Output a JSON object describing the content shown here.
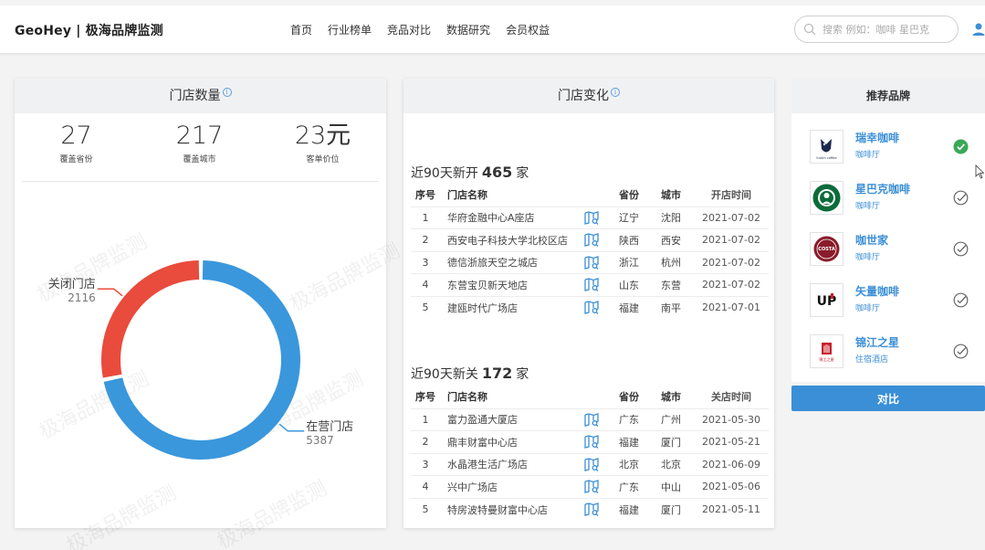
{
  "header": {
    "brand": "GeoHey | 极海品牌监测",
    "nav": [
      "首页",
      "行业榜单",
      "竞品对比",
      "数据研究",
      "会员权益"
    ],
    "search_placeholder": "搜索 例如：咖啡 星巴克"
  },
  "store_count": {
    "title": "门店数量",
    "stats": [
      {
        "value": "27",
        "label": "覆盖省份"
      },
      {
        "value": "217",
        "label": "覆盖城市"
      },
      {
        "value": "23元",
        "label": "客单价位"
      }
    ],
    "watermark": "极海品牌监测",
    "chart_data": {
      "type": "pie",
      "style": "donut",
      "slices": [
        {
          "label": "在营门店",
          "value": 5387,
          "color": "#3a97dc"
        },
        {
          "label": "关闭门店",
          "value": 2116,
          "color": "#e94b3c"
        }
      ]
    }
  },
  "store_change": {
    "title": "门店变化",
    "columns": [
      "序号",
      "门店名称",
      "省份",
      "城市"
    ],
    "opened": {
      "prefix": "近90天新开",
      "count": "465",
      "unit": "家",
      "date_col": "开店时间",
      "rows": [
        {
          "no": "1",
          "name": "华府金融中心A座店",
          "prov": "辽宁",
          "city": "沈阳",
          "date": "2021-07-02"
        },
        {
          "no": "2",
          "name": "西安电子科技大学北校区店",
          "prov": "陕西",
          "city": "西安",
          "date": "2021-07-02"
        },
        {
          "no": "3",
          "name": "德信浙旅天空之城店",
          "prov": "浙江",
          "city": "杭州",
          "date": "2021-07-02"
        },
        {
          "no": "4",
          "name": "东营宝贝新天地店",
          "prov": "山东",
          "city": "东营",
          "date": "2021-07-02"
        },
        {
          "no": "5",
          "name": "建瓯时代广场店",
          "prov": "福建",
          "city": "南平",
          "date": "2021-07-01"
        }
      ]
    },
    "closed": {
      "prefix": "近90天新关",
      "count": "172",
      "unit": "家",
      "date_col": "关店时间",
      "rows": [
        {
          "no": "1",
          "name": "富力盈通大厦店",
          "prov": "广东",
          "city": "广州",
          "date": "2021-05-30"
        },
        {
          "no": "2",
          "name": "鼎丰财富中心店",
          "prov": "福建",
          "city": "厦门",
          "date": "2021-05-21"
        },
        {
          "no": "3",
          "name": "水晶港生活广场店",
          "prov": "北京",
          "city": "北京",
          "date": "2021-06-09"
        },
        {
          "no": "4",
          "name": "兴中广场店",
          "prov": "广东",
          "city": "中山",
          "date": "2021-05-06"
        },
        {
          "no": "5",
          "name": "特房波特曼财富中心店",
          "prov": "福建",
          "city": "厦门",
          "date": "2021-05-11"
        }
      ]
    }
  },
  "recommend": {
    "title": "推荐品牌",
    "brands": [
      {
        "name": "瑞幸咖啡",
        "type": "咖啡厅",
        "selected": true,
        "logo_text": "luckin coffee"
      },
      {
        "name": "星巴克咖啡",
        "type": "咖啡厅",
        "selected": false
      },
      {
        "name": "咖世家",
        "type": "咖啡厅",
        "selected": false,
        "logo_text": "COSTA"
      },
      {
        "name": "矢量咖啡",
        "type": "咖啡厅",
        "selected": false,
        "logo_text": "UP"
      },
      {
        "name": "锦江之星",
        "type": "住宿酒店",
        "selected": false,
        "logo_text": "锦江之星"
      }
    ],
    "compare_label": "对比"
  },
  "colors": {
    "accent": "#3b8fd6",
    "open": "#3a97dc",
    "closed": "#e94b3c",
    "check_selected": "#3aa857"
  }
}
